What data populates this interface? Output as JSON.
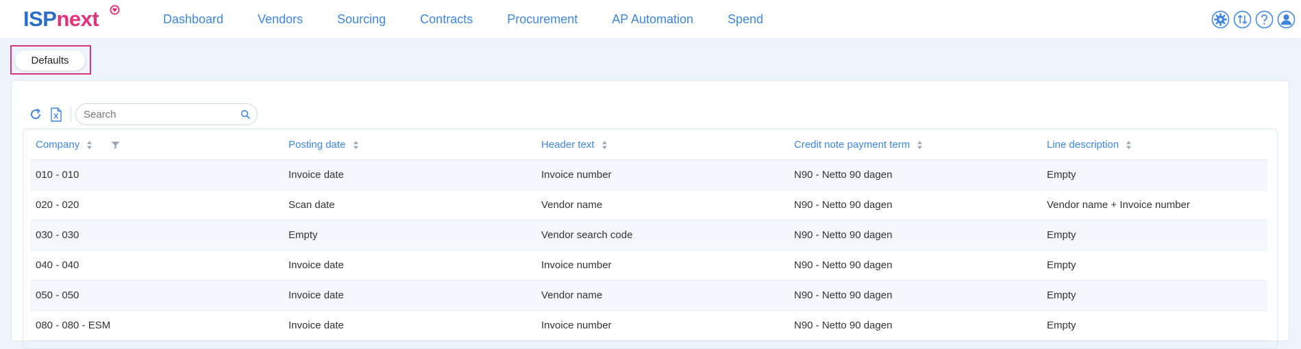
{
  "app": {
    "logo_primary": "ISP",
    "logo_secondary": "next"
  },
  "nav": {
    "items": [
      "Dashboard",
      "Vendors",
      "Sourcing",
      "Contracts",
      "Procurement",
      "AP Automation",
      "Spend"
    ]
  },
  "top_icons": [
    "settings-gear-icon",
    "sort-arrows-icon",
    "help-icon",
    "user-icon"
  ],
  "tabs": {
    "defaults_label": "Defaults"
  },
  "toolbar": {
    "refresh_icon": "refresh-icon",
    "export_icon": "excel-export-icon",
    "search_placeholder": "Search"
  },
  "table": {
    "columns": [
      "Company",
      "Posting date",
      "Header text",
      "Credit note payment term",
      "Line description"
    ],
    "rows": [
      [
        "010 - 010",
        "Invoice date",
        "Invoice number",
        "N90 - Netto 90 dagen",
        "Empty"
      ],
      [
        "020 - 020",
        "Scan date",
        "Vendor name",
        "N90 - Netto 90 dagen",
        "Vendor name + Invoice number"
      ],
      [
        "030 - 030",
        "Empty",
        "Vendor search code",
        "N90 - Netto 90 dagen",
        "Empty"
      ],
      [
        "040 - 040",
        "Invoice date",
        "Invoice number",
        "N90 - Netto 90 dagen",
        "Empty"
      ],
      [
        "050 - 050",
        "Invoice date",
        "Vendor name",
        "N90 - Netto 90 dagen",
        "Empty"
      ],
      [
        "080 - 080 - ESM",
        "Invoice date",
        "Invoice number",
        "N90 - Netto 90 dagen",
        "Empty"
      ]
    ]
  },
  "colors": {
    "brand_blue": "#2a6fc4",
    "brand_pink": "#e0337c",
    "link_blue": "#3f86dc",
    "highlight_frame": "#d63384"
  }
}
